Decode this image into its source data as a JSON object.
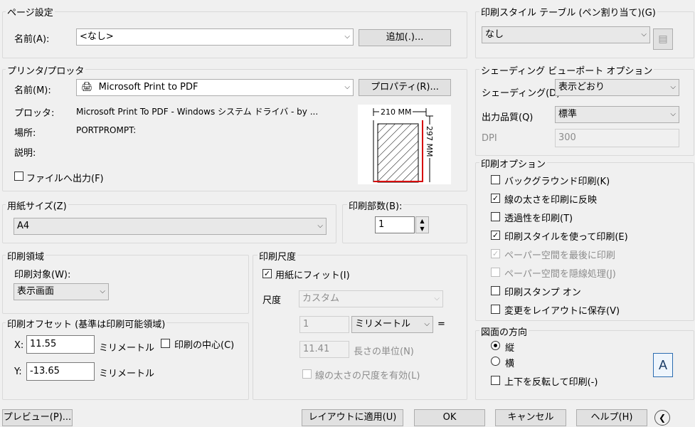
{
  "page_setup": {
    "title": "ページ設定",
    "name_label": "名前(A):",
    "name_value": "<なし>",
    "add_button": "追加(.)..."
  },
  "printer": {
    "title": "プリンタ/プロッタ",
    "name_label": "名前(M):",
    "name_value": "Microsoft Print to PDF",
    "properties_button": "プロパティ(R)...",
    "plotter_label": "プロッタ:",
    "plotter_value": "Microsoft Print To PDF - Windows システム ドライバ - by ...",
    "location_label": "場所:",
    "location_value": "PORTPROMPT:",
    "description_label": "説明:",
    "print_to_file": "ファイルへ出力(F)",
    "print_to_file_checked": false,
    "preview_width": "210  MM",
    "preview_height": "297  MM"
  },
  "paper_size": {
    "title": "用紙サイズ(Z)",
    "value": "A4"
  },
  "copies": {
    "title": "印刷部数(B):",
    "value": "1"
  },
  "plot_area": {
    "title": "印刷領域",
    "what_label": "印刷対象(W):",
    "what_value": "表示画面"
  },
  "plot_offset": {
    "title": "印刷オフセット (基準は印刷可能領域)",
    "x_label": "X:",
    "x_value": "11.55",
    "y_label": "Y:",
    "y_value": "-13.65",
    "unit": "ミリメートル",
    "center": "印刷の中心(C)",
    "center_checked": false
  },
  "plot_scale": {
    "title": "印刷尺度",
    "fit": "用紙にフィット(I)",
    "fit_checked": true,
    "scale_label": "尺度",
    "scale_value": "カスタム",
    "num_value": "1",
    "unit_value": "ミリメートル",
    "equals": "=",
    "den_value": "11.41",
    "units_label": "長さの単位(N)",
    "lineweights": "線の太さの尺度を有効(L)"
  },
  "style_table": {
    "title": "印刷スタイル テーブル (ペン割り当て)(G)",
    "value": "なし"
  },
  "shaded": {
    "title": "シェーディング ビューポート オプション",
    "shade_label": "シェーディング(D)",
    "shade_value": "表示どおり",
    "quality_label": "出力品質(Q)",
    "quality_value": "標準",
    "dpi_label": "DPI",
    "dpi_value": "300"
  },
  "options": {
    "title": "印刷オプション",
    "items": [
      {
        "label": "バックグラウンド印刷(K)",
        "checked": false,
        "enabled": true
      },
      {
        "label": "線の太さを印刷に反映",
        "checked": true,
        "enabled": true
      },
      {
        "label": "透過性を印刷(T)",
        "checked": false,
        "enabled": true
      },
      {
        "label": "印刷スタイルを使って印刷(E)",
        "checked": true,
        "enabled": true
      },
      {
        "label": "ペーパー空間を最後に印刷",
        "checked": true,
        "enabled": false
      },
      {
        "label": "ペーパー空間を隠線処理(J)",
        "checked": false,
        "enabled": false
      },
      {
        "label": "印刷スタンプ オン",
        "checked": false,
        "enabled": true
      },
      {
        "label": "変更をレイアウトに保存(V)",
        "checked": false,
        "enabled": true
      }
    ]
  },
  "orientation": {
    "title": "図面の方向",
    "portrait": "縦",
    "landscape": "横",
    "selected": "portrait",
    "upside_down": "上下を反転して印刷(-)",
    "icon_letter": "A"
  },
  "buttons": {
    "preview": "プレビュー(P)...",
    "apply": "レイアウトに適用(U)",
    "ok": "OK",
    "cancel": "キャンセル",
    "help": "ヘルプ(H)"
  }
}
